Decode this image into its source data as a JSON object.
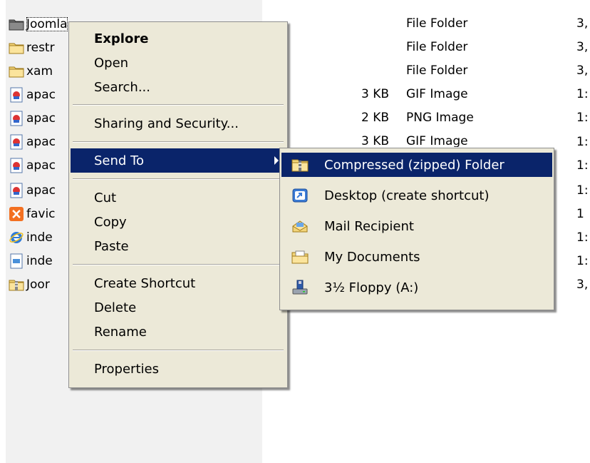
{
  "files": [
    {
      "name": "Joomla",
      "icon": "folder-dark-icon",
      "size": "",
      "type": "File Folder",
      "date": "3,",
      "selected": true
    },
    {
      "name": "restr",
      "icon": "folder-icon",
      "size": "",
      "type": "File Folder",
      "date": "3,"
    },
    {
      "name": "xam",
      "icon": "folder-icon",
      "size": "",
      "type": "File Folder",
      "date": "3,"
    },
    {
      "name": "apac",
      "icon": "image-file-icon",
      "size": "3 KB",
      "type": "GIF Image",
      "date": "1:"
    },
    {
      "name": "apac",
      "icon": "image-file-icon",
      "size": "2 KB",
      "type": "PNG Image",
      "date": "1:"
    },
    {
      "name": "apac",
      "icon": "image-file-icon",
      "size": "3 KB",
      "type": "GIF Image",
      "date": "1:"
    },
    {
      "name": "apac",
      "icon": "image-file-icon",
      "size": "",
      "type": "",
      "date": "1:"
    },
    {
      "name": "apac",
      "icon": "image-file-icon",
      "size": "",
      "type": "",
      "date": "1:"
    },
    {
      "name": "favic",
      "icon": "xampp-icon",
      "size": "",
      "type": "",
      "date": "1"
    },
    {
      "name": "inde",
      "icon": "ie-html-icon",
      "size": "",
      "type": "",
      "date": "1:"
    },
    {
      "name": "inde",
      "icon": "text-file-icon",
      "size": "",
      "type": "",
      "date": "1:"
    },
    {
      "name": "Joor",
      "icon": "zip-folder-icon",
      "size": "",
      "type": "",
      "date": "3,"
    }
  ],
  "context_menu": {
    "explore": "Explore",
    "open": "Open",
    "search": "Search...",
    "sharing": "Sharing and Security...",
    "send_to": "Send To",
    "cut": "Cut",
    "copy": "Copy",
    "paste": "Paste",
    "create_shortcut": "Create Shortcut",
    "delete": "Delete",
    "rename": "Rename",
    "properties": "Properties"
  },
  "send_to_menu": {
    "compressed": "Compressed (zipped) Folder",
    "desktop": "Desktop (create shortcut)",
    "mail": "Mail Recipient",
    "my_documents": "My Documents",
    "floppy": "3½ Floppy (A:)"
  },
  "colors": {
    "menu_bg": "#ece9d8",
    "highlight": "#0a246a",
    "pane_bg": "#f1f1f1"
  }
}
